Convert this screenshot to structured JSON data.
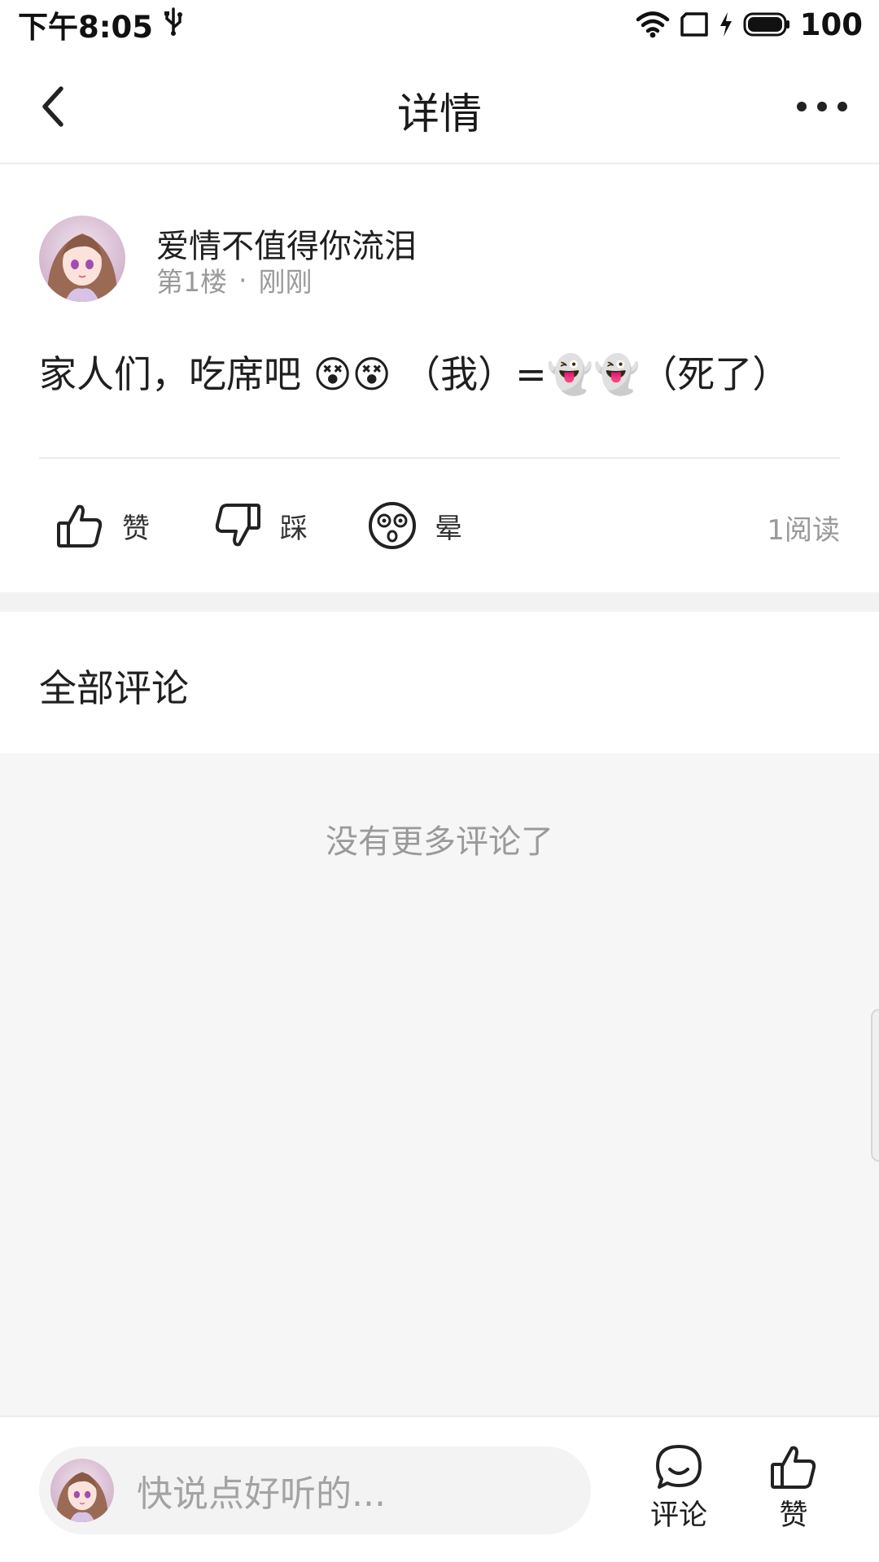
{
  "status_bar": {
    "time": "下午8:05",
    "battery": "100",
    "icons": [
      "usb-icon",
      "wifi-icon",
      "sim-icon",
      "charging-icon",
      "battery-icon"
    ]
  },
  "top_bar": {
    "title": "详情",
    "back_icon": "chevron-left-icon",
    "more_icon": "more-dots-icon"
  },
  "post": {
    "author": "爱情不值得你流泪",
    "floor": "第1楼",
    "separator": "·",
    "time": "刚刚",
    "content": "家人们，吃席吧 😵😵 （我）=👻👻（死了）",
    "actions": [
      {
        "icon": "thumbs-up-icon",
        "label": "赞"
      },
      {
        "icon": "thumbs-down-icon",
        "label": "踩"
      },
      {
        "icon": "dizzy-face-icon",
        "label": "晕"
      }
    ],
    "read_count": "1阅读"
  },
  "comments": {
    "title": "全部评论",
    "empty_text": "没有更多评论了"
  },
  "bottom_bar": {
    "placeholder": "快说点好听的...",
    "comment_label": "评论",
    "like_label": "赞"
  },
  "colors": {
    "background": "#ffffff",
    "comments_background": "#f6f6f6",
    "muted_text": "#9a9a9a",
    "primary_text": "#1f1f1f"
  }
}
